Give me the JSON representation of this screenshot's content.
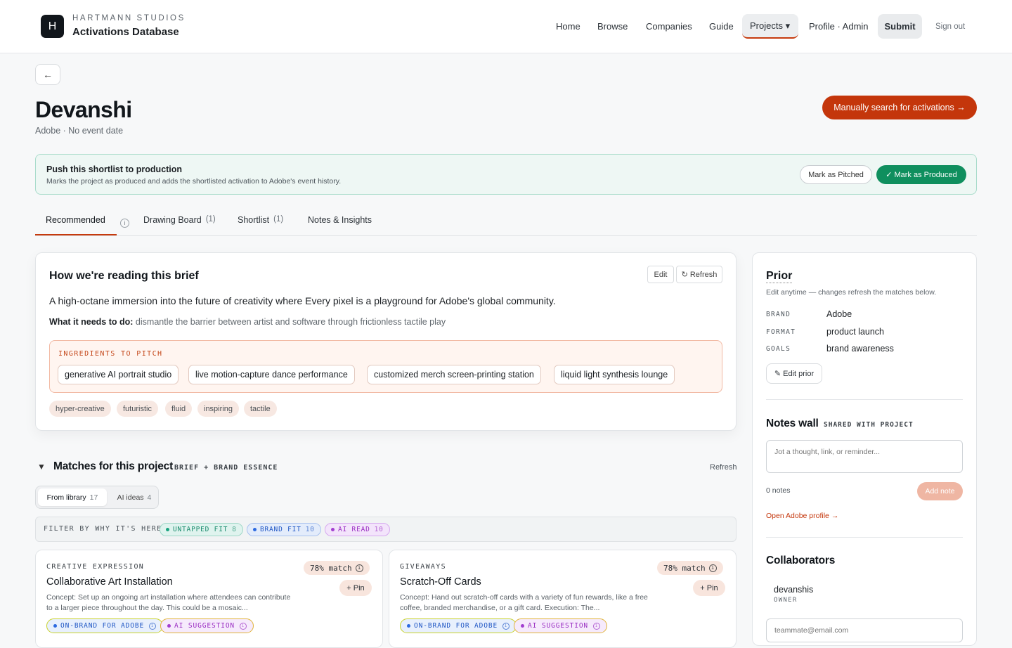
{
  "header": {
    "logo_letter": "H",
    "studio": "HARTMANN STUDIOS",
    "app_name": "Activations Database",
    "nav": {
      "home": "Home",
      "browse": "Browse",
      "companies": "Companies",
      "guide": "Guide",
      "projects": "Projects ▾",
      "profile": "Profile · Admin",
      "submit": "Submit",
      "signout": "Sign out"
    }
  },
  "project": {
    "back": "←",
    "title": "Devanshi",
    "subtitle": "Adobe · No event date",
    "manual_search": "Manually search for activations →"
  },
  "push": {
    "title": "Push this shortlist to production",
    "subtitle": "Marks the project as produced and adds the shortlisted activation to Adobe's event history.",
    "pitched": "Mark as Pitched",
    "produced": "✓ Mark as Produced"
  },
  "tabs": {
    "recommended": "Recommended",
    "info": "i",
    "drawing_board": "Drawing Board",
    "drawing_board_count": "(1)",
    "shortlist": "Shortlist",
    "shortlist_count": "(1)",
    "notes": "Notes & Insights"
  },
  "brief": {
    "title": "How we're reading this brief",
    "edit": "Edit",
    "refresh": "↻ Refresh",
    "summary": "A high-octane immersion into the future of creativity where Every pixel is a playground for Adobe's global community.",
    "needs_label": "What it needs to do:",
    "needs_text": "dismantle the barrier between artist and software through frictionless tactile play",
    "ingredients_label": "INGREDIENTS TO PITCH",
    "ingredients": [
      "generative AI portrait studio",
      "live motion-capture dance performance",
      "customized merch screen-printing station",
      "liquid light synthesis lounge"
    ],
    "tones": [
      "hyper-creative",
      "futuristic",
      "fluid",
      "inspiring",
      "tactile"
    ]
  },
  "matches": {
    "caret": "▼",
    "title": "Matches for this project",
    "tag": "BRIEF + BRAND ESSENCE",
    "refresh": "Refresh",
    "seg_library": "From library",
    "seg_library_count": "17",
    "seg_ai": "AI ideas",
    "seg_ai_count": "4",
    "filter_label": "FILTER BY WHY IT'S HERE:",
    "filters": [
      {
        "label": "UNTAPPED FIT",
        "count": "8",
        "bg": "#dff3ee",
        "border": "#9fd7c7",
        "fg": "#178a6b",
        "dot": "#1aa37f"
      },
      {
        "label": "BRAND FIT",
        "count": "10",
        "bg": "#e3ecfb",
        "border": "#a9c2ee",
        "fg": "#1f56c4",
        "dot": "#2d6ae0"
      },
      {
        "label": "AI READ",
        "count": "10",
        "bg": "#f3e4fb",
        "border": "#d6a9ef",
        "fg": "#9a2dc2",
        "dot": "#a23fd0"
      }
    ],
    "cards": [
      {
        "category": "CREATIVE EXPRESSION",
        "title": "Collaborative Art Installation",
        "desc": "Concept: Set up an ongoing art installation where attendees can contribute to a larger piece throughout the day. This could be a mosaic...",
        "match": "78% match",
        "pin": "+ Pin",
        "badge_brand": "ON-BRAND FOR ADOBE",
        "badge_ai": "AI SUGGESTION"
      },
      {
        "category": "GIVEAWAYS",
        "title": "Scratch-Off Cards",
        "desc": "Concept: Hand out scratch-off cards with a variety of fun rewards, like a free coffee, branded merchandise, or a gift card. Execution: The...",
        "match": "78% match",
        "pin": "+ Pin",
        "badge_brand": "ON-BRAND FOR ADOBE",
        "badge_ai": "AI SUGGESTION"
      }
    ]
  },
  "side": {
    "prior_title": "Prior",
    "prior_sub": "Edit anytime — changes refresh the matches below.",
    "fields": [
      {
        "key": "BRAND",
        "value": "Adobe"
      },
      {
        "key": "FORMAT",
        "value": "product launch"
      },
      {
        "key": "GOALS",
        "value": "brand awareness"
      }
    ],
    "edit_prior": "✎ Edit prior",
    "notes_title": "Notes wall",
    "notes_tag": "SHARED WITH PROJECT",
    "notes_placeholder": "Jot a thought, link, or reminder...",
    "notes_count": "0 notes",
    "add_note": "Add note",
    "open_profile": "Open Adobe profile →",
    "collab_title": "Collaborators",
    "collab_name": "devanshis",
    "collab_role": "OWNER",
    "collab_placeholder": "teammate@email.com"
  }
}
